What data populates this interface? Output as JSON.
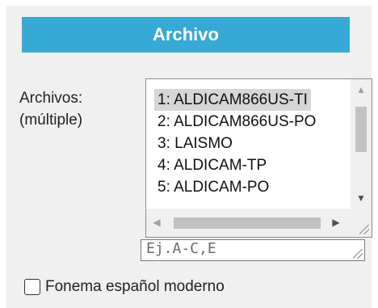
{
  "section": {
    "title": "Archivo"
  },
  "files": {
    "label": "Archivos:\n(múltiple)",
    "label_line1": "Archivos:",
    "label_line2": "(múltiple)",
    "items": [
      {
        "label": "1: ALDICAM866US-TI",
        "selected": true
      },
      {
        "label": "2: ALDICAM866US-PO",
        "selected": false
      },
      {
        "label": "3: LAISMO",
        "selected": false
      },
      {
        "label": "4: ALDICAM-TP",
        "selected": false
      },
      {
        "label": "5: ALDICAM-PO",
        "selected": false
      }
    ]
  },
  "range": {
    "placeholder": "Ej.A-C,E",
    "value": ""
  },
  "options": {
    "modern_phoneme_label": "Fonema español moderno",
    "modern_phoneme_checked": false
  },
  "colors": {
    "header_bg": "#36a9d6",
    "panel_bg": "#f0f0f0",
    "selected_bg": "#d6d6d6"
  }
}
